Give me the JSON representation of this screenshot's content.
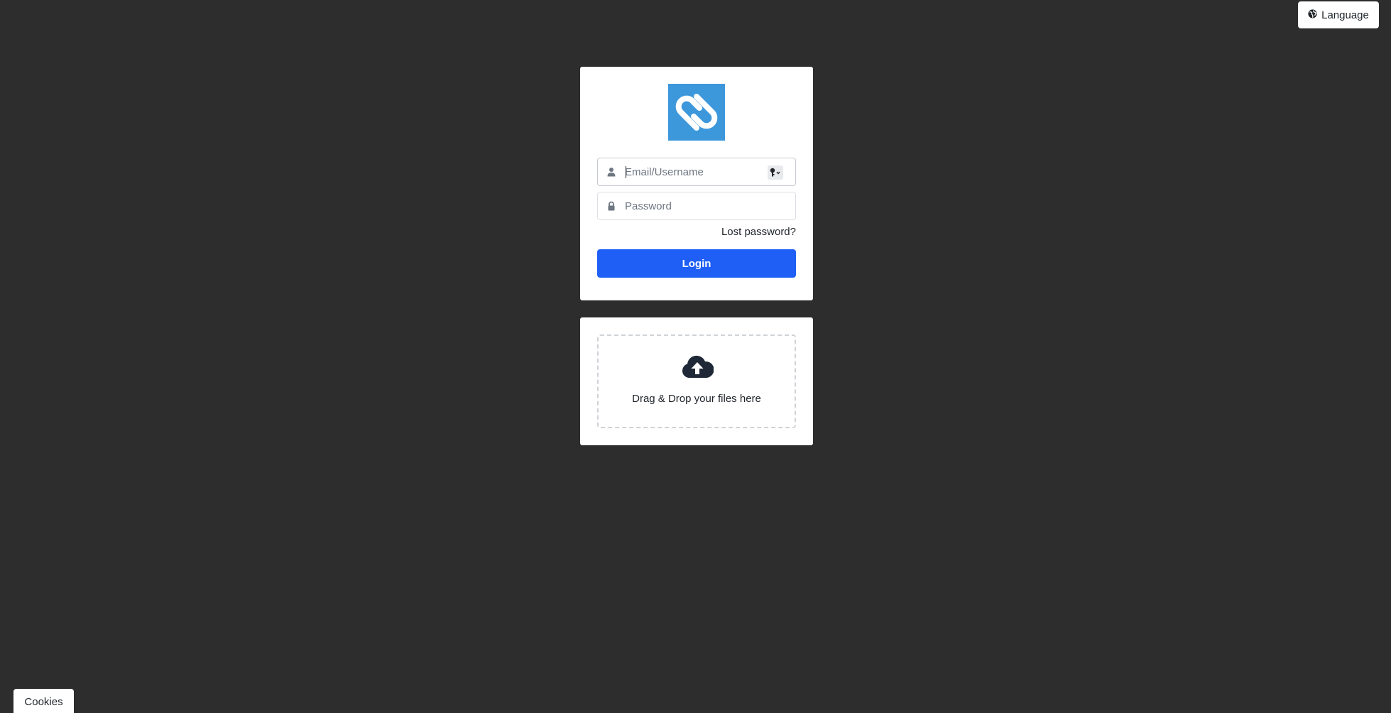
{
  "header": {
    "language_label": "Language",
    "language_icon": "globe-icon"
  },
  "login": {
    "logo_icon": "heart-link-logo",
    "logo_color": "#3d97db",
    "username": {
      "value": "",
      "placeholder": "Email/Username",
      "icon": "user-icon",
      "addon_icon": "key-icon"
    },
    "password": {
      "value": "",
      "placeholder": "Password",
      "icon": "lock-icon"
    },
    "lost_password_label": "Lost password?",
    "login_button_label": "Login",
    "login_button_color": "#1f5ff6"
  },
  "upload": {
    "icon": "cloud-upload-icon",
    "text": "Drag & Drop your files here"
  },
  "footer": {
    "cookies_label": "Cookies"
  }
}
